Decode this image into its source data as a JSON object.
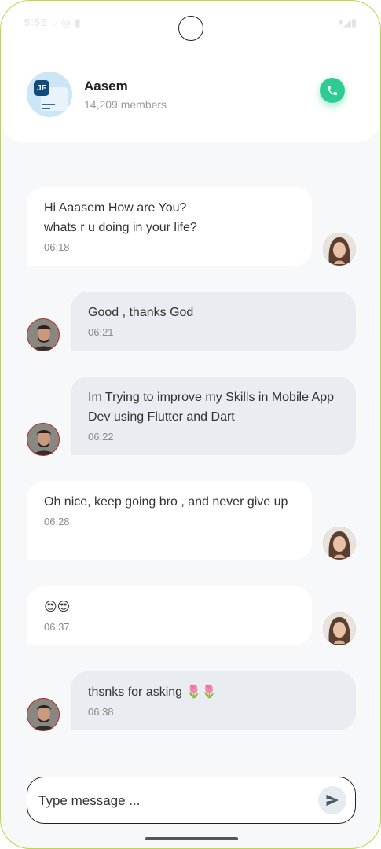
{
  "status": {
    "left": "5:55 ◌ ◎ ▮",
    "right": "▾◢▮"
  },
  "header": {
    "avatar_initials": "JF",
    "title": "Aasem",
    "members": "14,209 members"
  },
  "messages": [
    {
      "text": "Hi Aaasem How are You?\nwhats r u doing in your life?",
      "time": "06:18"
    },
    {
      "text": "Good , thanks God",
      "time": "06:21"
    },
    {
      "text": "Im Trying to improve my Skills in Mobile App Dev using Flutter and Dart",
      "time": "06:22"
    },
    {
      "text": "Oh nice, keep going bro , and never give up",
      "time": "06:28"
    },
    {
      "text": "😍😍",
      "time": "06:37"
    },
    {
      "text": "thsnks for asking 🌷🌷",
      "time": "06:38"
    }
  ],
  "composer": {
    "placeholder": "Type message ..."
  },
  "colors": {
    "accent": "#2ecc92",
    "incoming_bg": "#ffffff",
    "outgoing_bg": "#e9ecf0"
  },
  "icons": {
    "call": "phone-icon",
    "send": "send-icon"
  }
}
